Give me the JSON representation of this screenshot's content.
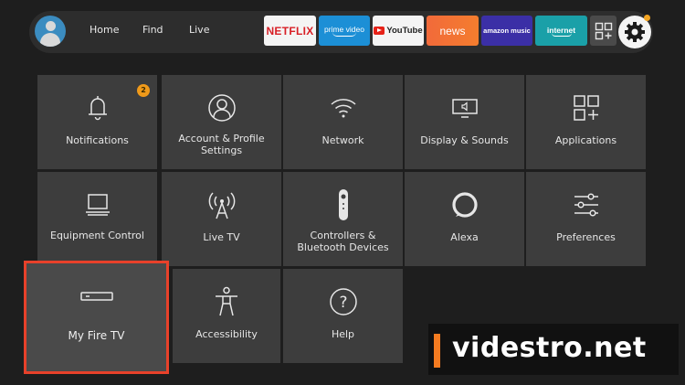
{
  "topbar": {
    "nav": [
      "Home",
      "Find",
      "Live"
    ],
    "apps": {
      "netflix": "NETFLIX",
      "prime_video": "prime video",
      "youtube": "YouTube",
      "news": "news",
      "amazon_music": "amazon music",
      "internet": "internet"
    }
  },
  "settings": {
    "tiles": [
      {
        "label": "Notifications",
        "icon": "bell-icon",
        "badge": "2"
      },
      {
        "label": "Account & Profile Settings",
        "icon": "person-icon"
      },
      {
        "label": "Network",
        "icon": "wifi-icon"
      },
      {
        "label": "Display & Sounds",
        "icon": "display-sound-icon"
      },
      {
        "label": "Applications",
        "icon": "apps-grid-icon"
      },
      {
        "label": "Equipment Control",
        "icon": "computer-icon"
      },
      {
        "label": "Live TV",
        "icon": "antenna-icon"
      },
      {
        "label": "Controllers & Bluetooth Devices",
        "icon": "remote-icon"
      },
      {
        "label": "Alexa",
        "icon": "alexa-icon"
      },
      {
        "label": "Preferences",
        "icon": "sliders-icon"
      },
      {
        "label": "My Fire TV",
        "icon": "fire-tv-device-icon"
      },
      {
        "label": "Accessibility",
        "icon": "accessibility-icon"
      },
      {
        "label": "Help",
        "icon": "help-icon"
      }
    ],
    "focused": "My Fire TV"
  },
  "watermark": {
    "text": "videstro.net"
  },
  "colors": {
    "background": "#1e1e1e",
    "tile": "#3d3d3d",
    "focus_border": "#e8412a",
    "badge": "#f09a1a",
    "watermark_accent": "#f47b20"
  }
}
